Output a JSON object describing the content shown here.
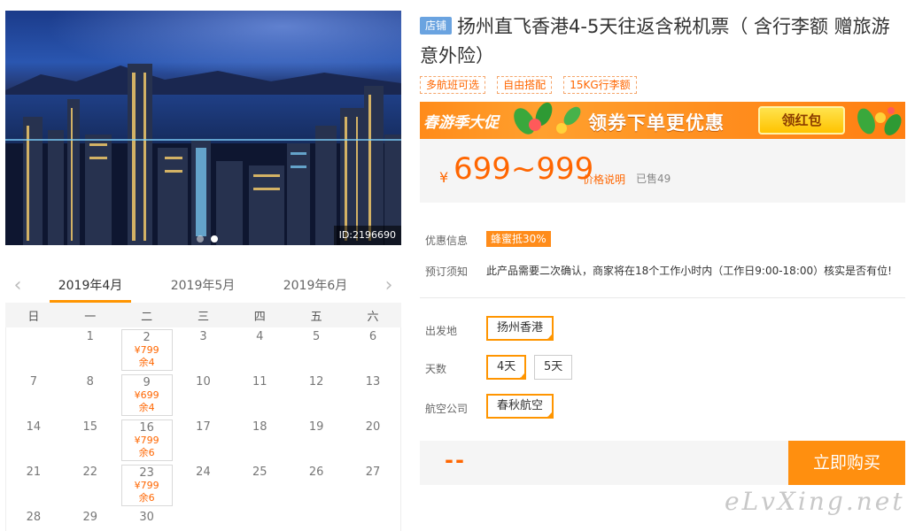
{
  "hero": {
    "image_id": "ID:2196690",
    "dots": 2,
    "active_dot": 1
  },
  "calendar": {
    "months": [
      "2019年4月",
      "2019年5月",
      "2019年6月"
    ],
    "active_month": 0,
    "weekdays": [
      "日",
      "一",
      "二",
      "三",
      "四",
      "五",
      "六"
    ],
    "weeks": [
      [
        {
          "d": ""
        },
        {
          "d": "1"
        },
        {
          "d": "2",
          "price": "¥799",
          "stock": "余4"
        },
        {
          "d": "3"
        },
        {
          "d": "4"
        },
        {
          "d": "5"
        },
        {
          "d": "6"
        }
      ],
      [
        {
          "d": "7"
        },
        {
          "d": "8"
        },
        {
          "d": "9",
          "price": "¥699",
          "stock": "余4"
        },
        {
          "d": "10"
        },
        {
          "d": "11"
        },
        {
          "d": "12"
        },
        {
          "d": "13"
        }
      ],
      [
        {
          "d": "14"
        },
        {
          "d": "15"
        },
        {
          "d": "16",
          "price": "¥799",
          "stock": "余6"
        },
        {
          "d": "17"
        },
        {
          "d": "18"
        },
        {
          "d": "19"
        },
        {
          "d": "20"
        }
      ],
      [
        {
          "d": "21"
        },
        {
          "d": "22"
        },
        {
          "d": "23",
          "price": "¥799",
          "stock": "余6"
        },
        {
          "d": "24"
        },
        {
          "d": "25"
        },
        {
          "d": "26"
        },
        {
          "d": "27"
        }
      ],
      [
        {
          "d": "28"
        },
        {
          "d": "29"
        },
        {
          "d": "30"
        },
        {
          "d": ""
        },
        {
          "d": ""
        },
        {
          "d": ""
        },
        {
          "d": ""
        }
      ]
    ]
  },
  "product": {
    "shop_badge": "店铺",
    "title": "扬州直飞香港4-5天往返含税机票（ 含行李额 赠旅游意外险）",
    "tags": [
      "多航班可选",
      "自由搭配",
      "15KG行李额"
    ]
  },
  "banner": {
    "spring": "春游季大促",
    "slogan": "领券下单更优惠",
    "button": "领红包"
  },
  "price": {
    "currency": "¥",
    "range": "699~999",
    "note": "价格说明",
    "sold": "已售49"
  },
  "info": {
    "promo_label": "优惠信息",
    "promo_badge": "蜂蜜抵30%",
    "notice_label": "预订须知",
    "notice_text": "此产品需要二次确认，商家将在18个工作小时内（工作日9:00-18:00）核实是否有位!"
  },
  "options": {
    "departure_label": "出发地",
    "departure": [
      "扬州香港"
    ],
    "days_label": "天数",
    "days": [
      "4天",
      "5天"
    ],
    "airline_label": "航空公司",
    "airline": [
      "春秋航空"
    ]
  },
  "buy": {
    "total": "--",
    "button": "立即购买"
  },
  "watermark": "eLvXing.net",
  "colors": {
    "accent": "#ff9500",
    "price": "#ff6600",
    "badge_blue": "#6aa3e0"
  }
}
